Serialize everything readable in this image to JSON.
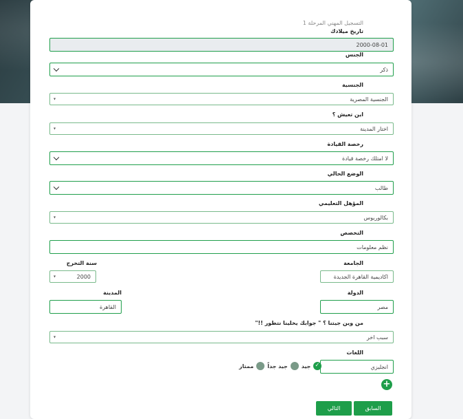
{
  "form": {
    "step_title": "التسجيل المهني المرحلة 1",
    "birthdate_label": "تاريخ ميلادك",
    "birthdate_value": "2000-08-01",
    "gender_label": "الجنس",
    "gender_value": "ذكر",
    "nationality_label": "الجنسية",
    "nationality_value": "الجنسية المصرية",
    "city_label": "اين تعيش ؟",
    "city_value": "اختار المدينة",
    "license_label": "رخصة القيادة",
    "license_value": "لا امتلك رخصة قيادة",
    "status_label": "الوضع الحالي",
    "status_value": "طالب",
    "education_label": "المؤهل التعليمي",
    "education_value": "بكالوريوس",
    "specialty_label": "التخصص",
    "specialty_value": "نظم معلومات",
    "university_label": "الجامعة",
    "university_value": "اكاديمية القاهرة الجديدة",
    "grad_year_label": "سنة التخرج",
    "grad_year_value": "2000",
    "country_label": "الدولة",
    "country_value": "مصر",
    "city2_label": "المدينة",
    "city2_value": "القاهرة",
    "source_label": "من وين جيتنا ؟ \" جوابك يخلينا نتطور !!\"",
    "source_value": "سبب اخر",
    "languages_label": "اللغات",
    "language_value": "انجليزي",
    "levels": [
      "جيد",
      "جيد جداً",
      "ممتاز"
    ],
    "prev_button": "السابق",
    "next_button": "التالي"
  },
  "colors": {
    "accent": "#1e9e4a"
  }
}
